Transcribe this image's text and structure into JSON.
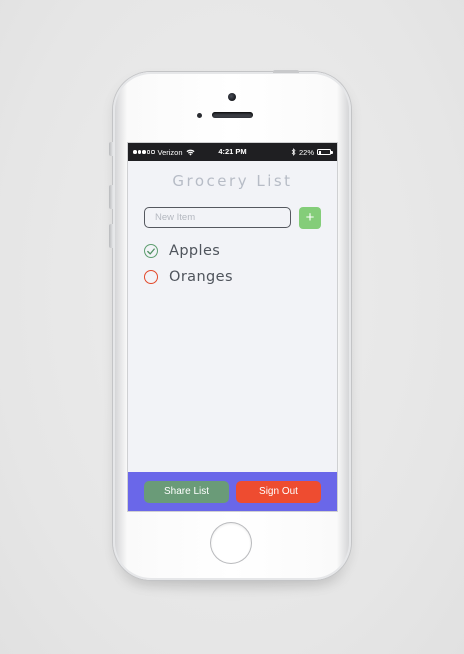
{
  "status_bar": {
    "carrier": "Verizon",
    "time": "4:21 PM",
    "battery_text": "22%",
    "battery_level": 0.22,
    "signal_bars_filled": 3,
    "signal_bars_total": 5,
    "icons": [
      "signal-dots-icon",
      "wifi-icon",
      "bluetooth-icon",
      "battery-icon"
    ]
  },
  "app": {
    "title": "Grocery List",
    "new_item_placeholder": "New Item",
    "new_item_value": "",
    "add_button_label": "+",
    "items": [
      {
        "label": "Apples",
        "checked": true,
        "color": "#5e9e70"
      },
      {
        "label": "Oranges",
        "checked": false,
        "color": "#e34a2c"
      }
    ],
    "share_label": "Share List",
    "signout_label": "Sign Out"
  },
  "colors": {
    "accent_bar": "#6a67e9",
    "add_button": "#84cd79",
    "share_button": "#6a9b78",
    "signout_button": "#ee4c30",
    "title_text": "#b7bcc6",
    "screen_bg": "#f2f3f7"
  }
}
